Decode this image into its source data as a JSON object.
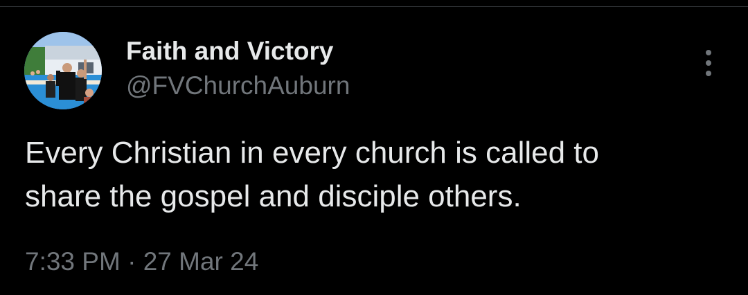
{
  "tweet": {
    "author": {
      "display_name": "Faith and Victory",
      "handle": "@FVChurchAuburn",
      "avatar_icon": "profile-photo"
    },
    "more_icon": "more-vertical-icon",
    "text": "Every Christian in every church is called to\nshare the gospel and disciple others.",
    "time": "7:33 PM",
    "separator": "·",
    "date": "27 Mar 24"
  },
  "colors": {
    "background": "#000000",
    "primary_text": "#e7e9ea",
    "secondary_text": "#71767b",
    "divider": "#2f3336"
  }
}
